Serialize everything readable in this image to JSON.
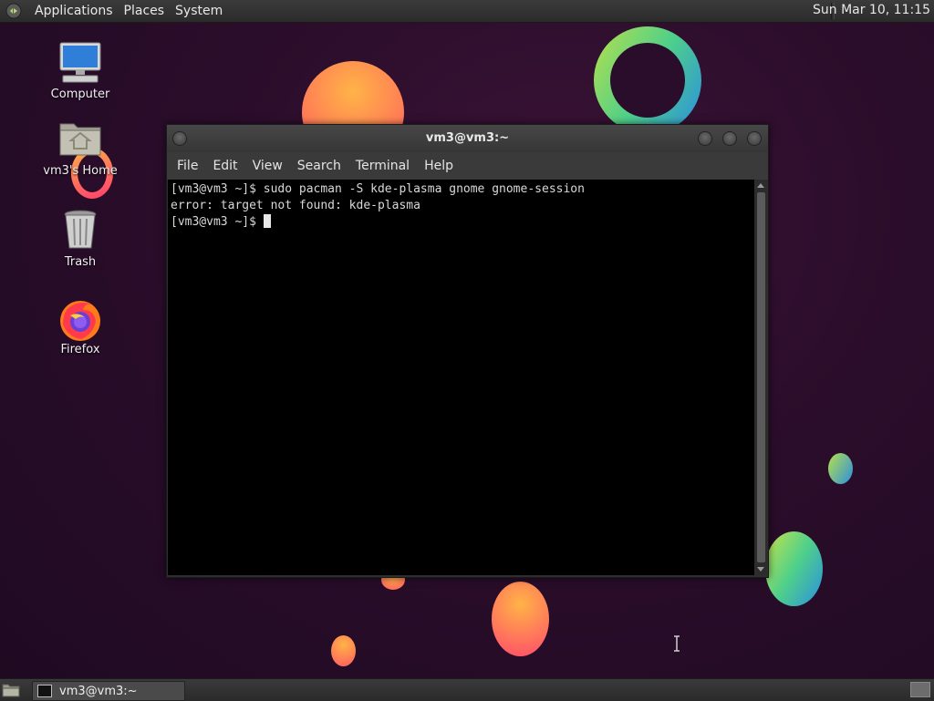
{
  "top_panel": {
    "menus": [
      "Applications",
      "Places",
      "System"
    ],
    "clock": "Sun Mar 10, 11:15"
  },
  "desktop_icons": [
    {
      "label": "Computer",
      "icon": "computer-icon"
    },
    {
      "label": "vm3's Home",
      "icon": "home-folder-icon"
    },
    {
      "label": "Trash",
      "icon": "trash-icon"
    },
    {
      "label": "Firefox",
      "icon": "firefox-icon"
    }
  ],
  "window": {
    "title": "vm3@vm3:~",
    "menus": [
      "File",
      "Edit",
      "View",
      "Search",
      "Terminal",
      "Help"
    ],
    "terminal_lines": [
      "[vm3@vm3 ~]$ sudo pacman -S kde-plasma gnome gnome-session",
      "error: target not found: kde-plasma",
      "[vm3@vm3 ~]$ "
    ]
  },
  "taskbar": {
    "task_label": "vm3@vm3:~"
  },
  "colors": {
    "wallpaper": "#2a0d2a",
    "terminal_bg": "#000000",
    "panel": "#333333"
  }
}
